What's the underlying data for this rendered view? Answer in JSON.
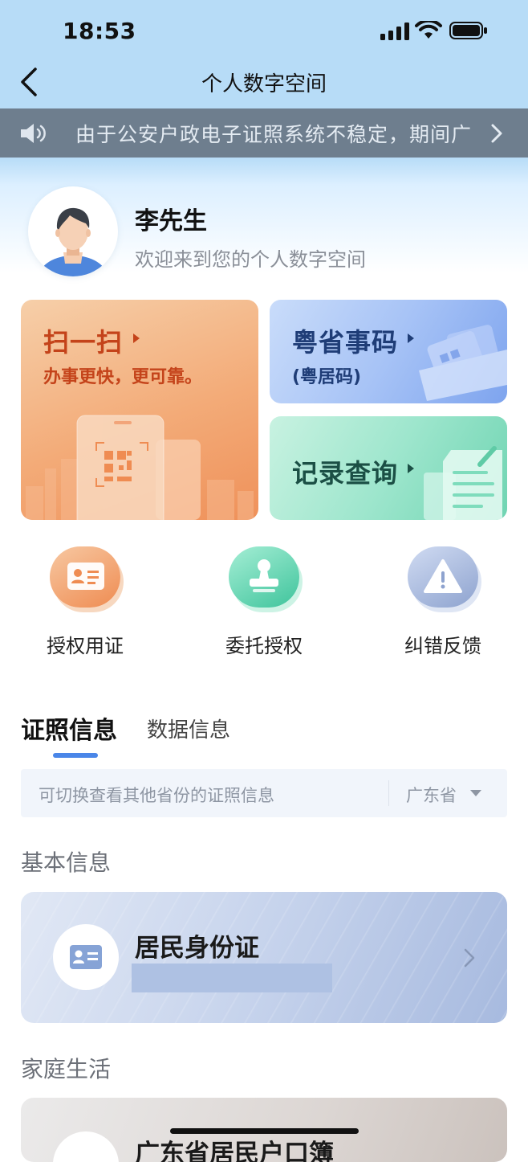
{
  "status_bar": {
    "time": "18:53"
  },
  "nav": {
    "title": "个人数字空间"
  },
  "notice": {
    "text": "由于公安户政电子证照系统不稳定，期间广"
  },
  "profile": {
    "name": "李先生",
    "welcome": "欢迎来到您的个人数字空间"
  },
  "cards": {
    "scan": {
      "title": "扫一扫",
      "subtitle": "办事更快，更可靠。"
    },
    "code": {
      "title": "粤省事码",
      "subtitle": "(粤居码)"
    },
    "record": {
      "title": "记录查询"
    }
  },
  "shortcuts": [
    {
      "label": "授权用证",
      "icon": "id-card-icon",
      "color": "#f0955a"
    },
    {
      "label": "委托授权",
      "icon": "stamp-icon",
      "color": "#4fcfa8"
    },
    {
      "label": "纠错反馈",
      "icon": "warning-icon",
      "color": "#8ea3cf"
    }
  ],
  "tabs": [
    {
      "label": "证照信息",
      "active": true
    },
    {
      "label": "数据信息",
      "active": false
    }
  ],
  "province": {
    "hint": "可切换查看其他省份的证照信息",
    "selected": "广东省"
  },
  "sections": {
    "basic": {
      "title": "基本信息",
      "items": [
        {
          "title": "居民身份证"
        }
      ]
    },
    "family": {
      "title": "家庭生活",
      "items": [
        {
          "title": "广东省居民户口簿"
        }
      ]
    }
  },
  "colors": {
    "accent": "#4a86e8",
    "notice_bg": "#6e7e8e",
    "header_bg": "#b7dcf7"
  }
}
